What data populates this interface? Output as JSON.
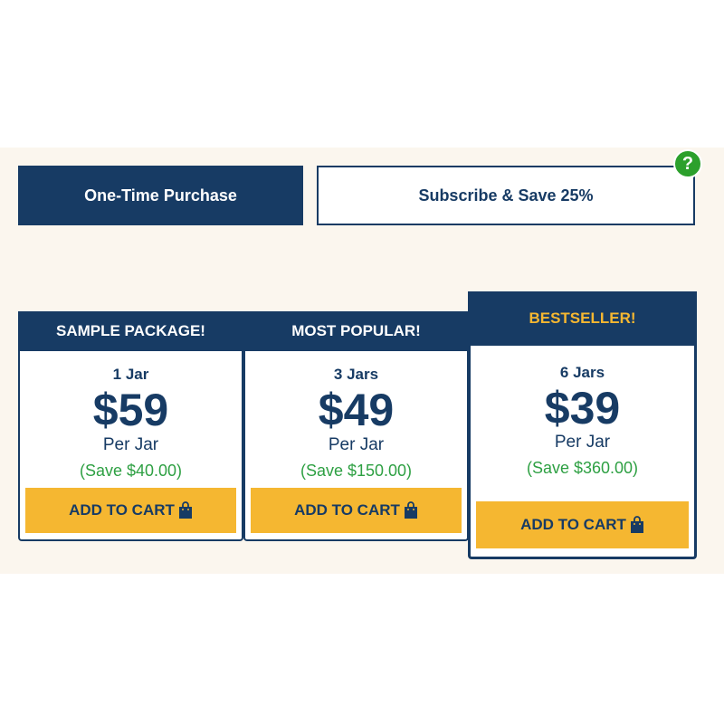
{
  "tabs": {
    "one_time": "One-Time Purchase",
    "subscribe": "Subscribe & Save 25%",
    "help_symbol": "?"
  },
  "colors": {
    "navy": "#173b64",
    "gold": "#f5b731",
    "green": "#2ea043",
    "cream": "#fbf6ee"
  },
  "packages": [
    {
      "badge": "SAMPLE PACKAGE!",
      "quantity": "1 Jar",
      "price": "$59",
      "per": "Per Jar",
      "savings": "(Save $40.00)",
      "button": "ADD TO CART",
      "icon": "shopping-bag-icon"
    },
    {
      "badge": "MOST POPULAR!",
      "quantity": "3 Jars",
      "price": "$49",
      "per": "Per Jar",
      "savings": "(Save $150.00)",
      "button": "ADD TO CART",
      "icon": "shopping-bag-icon"
    },
    {
      "badge": "BESTSELLER!",
      "quantity": "6 Jars",
      "price": "$39",
      "per": "Per Jar",
      "savings": "(Save $360.00)",
      "button": "ADD TO CART",
      "icon": "shopping-bag-icon"
    }
  ]
}
